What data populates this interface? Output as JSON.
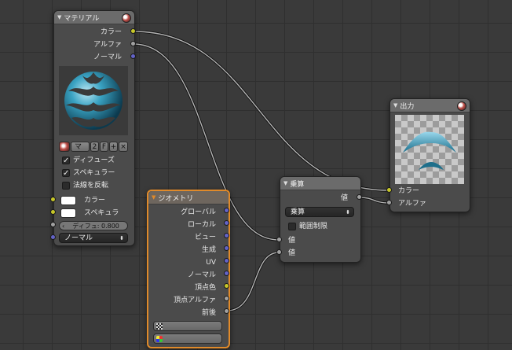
{
  "material_node": {
    "title": "マテリアル",
    "outputs": [
      "カラー",
      "アルファ",
      "ノーマル"
    ],
    "toolbar": {
      "material_name": "マ",
      "users": "2",
      "fake_user": "F"
    },
    "checks": [
      {
        "label": "ディフューズ",
        "checked": true
      },
      {
        "label": "スペキュラー",
        "checked": true
      },
      {
        "label": "法線を反転",
        "checked": false
      }
    ],
    "color_inputs": [
      "カラー",
      "スペキュラ"
    ],
    "diffuse_field": "ディフュ: 0.800",
    "normal_select": "ノーマル"
  },
  "geometry_node": {
    "title": "ジオメトリ",
    "outputs": [
      "グローバル",
      "ローカル",
      "ビュー",
      "生成",
      "UV",
      "ノーマル",
      "頂点色",
      "頂点アルファ",
      "前後"
    ]
  },
  "math_node": {
    "title": "乗算",
    "output": "値",
    "operation": "乗算",
    "clamp_label": "範囲制限",
    "inputs": [
      "値",
      "値"
    ]
  },
  "output_node": {
    "title": "出力",
    "inputs": [
      "カラー",
      "アルファ"
    ]
  },
  "socket_colors": {
    "color": "#c7c729",
    "value": "#a1a1a1",
    "vector": "#6363c7"
  }
}
